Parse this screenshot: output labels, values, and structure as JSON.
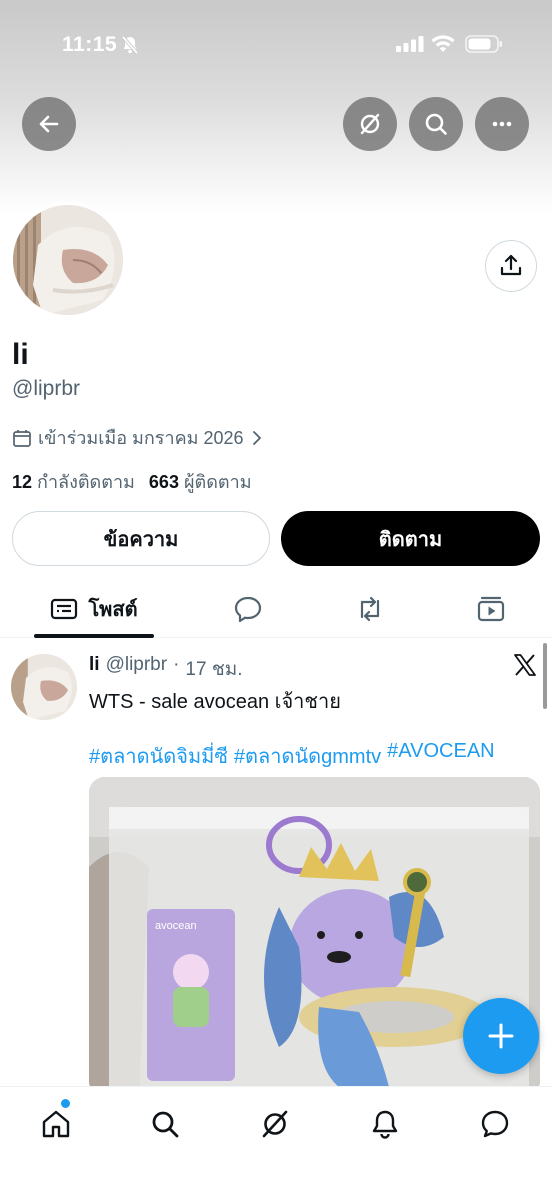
{
  "status_bar": {
    "time": "11:15"
  },
  "profile": {
    "display_name": "li",
    "handle": "@liprbr",
    "joined": "เข้าร่วมเมือ มกราคม 2026",
    "following_count": "12",
    "following_label": "กำลังติดตาม",
    "followers_count": "663",
    "followers_label": "ผู้ติดตาม"
  },
  "actions": {
    "message_label": "ข้อความ",
    "follow_label": "ติดตาม"
  },
  "tabs": [
    {
      "label": "โพสต์",
      "icon": "posts-icon",
      "selected": true
    },
    {
      "label": "",
      "icon": "replies-icon"
    },
    {
      "label": "",
      "icon": "reposts-icon"
    },
    {
      "label": "",
      "icon": "media-icon"
    }
  ],
  "post": {
    "name": "li",
    "handle": "@liprbr",
    "separator": "·",
    "time": "17 ชม.",
    "text": "WTS - sale avocean เจ้าชาย",
    "hashtags": [
      "#ตลาดนัดจิมมี่ซี",
      "#ตลาดนัดgmmtv",
      "#AVOCEAN"
    ],
    "card_text": "avocean"
  },
  "bottom_nav": [
    "home-icon",
    "search-icon",
    "grok-icon",
    "notifications-icon",
    "messages-icon"
  ],
  "colors": {
    "accent": "#1d9bf0",
    "text": "#0f1419",
    "secondary": "#536471",
    "follow_button": "#000000"
  }
}
